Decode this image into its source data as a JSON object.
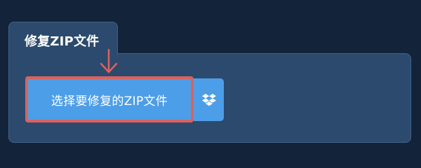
{
  "tab": {
    "label": "修复ZIP文件"
  },
  "upload": {
    "select_label": "选择要修复的ZIP文件",
    "dropbox_icon": "dropbox-icon"
  },
  "colors": {
    "background": "#13243a",
    "panel": "#2c4a6d",
    "button": "#4d9ee8",
    "highlight": "#d9635f"
  }
}
